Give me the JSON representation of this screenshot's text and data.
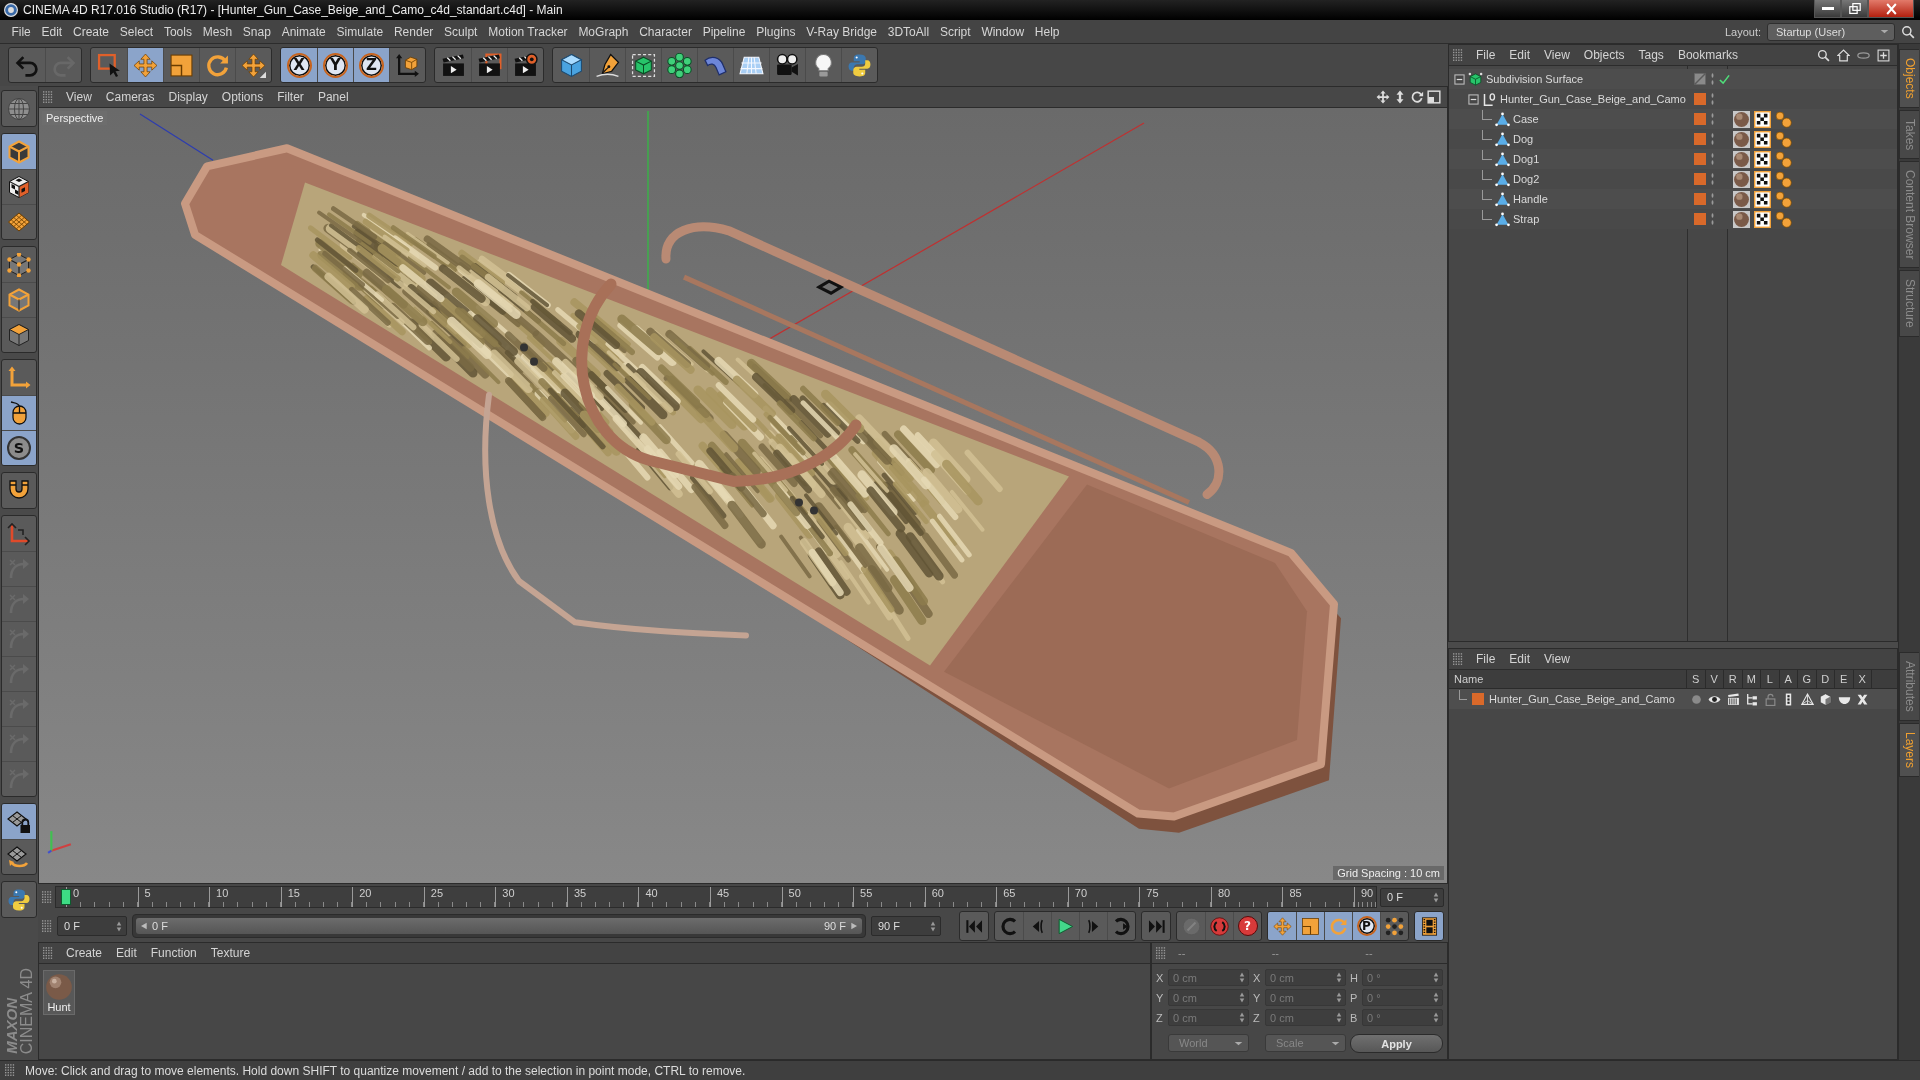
{
  "window": {
    "title": "CINEMA 4D R17.016 Studio (R17) - [Hunter_Gun_Case_Beige_and_Camo_c4d_standart.c4d] - Main"
  },
  "menu_bar": {
    "items": [
      "File",
      "Edit",
      "Create",
      "Select",
      "Tools",
      "Mesh",
      "Snap",
      "Animate",
      "Simulate",
      "Render",
      "Sculpt",
      "Motion Tracker",
      "MoGraph",
      "Character",
      "Pipeline",
      "Plugins",
      "V-Ray Bridge",
      "3DToAll",
      "Script",
      "Window",
      "Help"
    ],
    "layout_label": "Layout:",
    "layout_value": "Startup (User)"
  },
  "toolbar": {
    "groups": [
      [
        {
          "kind": "undo",
          "selected": false,
          "disabled": false
        },
        {
          "kind": "redo",
          "selected": false,
          "disabled": true
        }
      ],
      [
        {
          "kind": "live-select",
          "selected": false,
          "disabled": false
        },
        {
          "kind": "move",
          "selected": true,
          "disabled": false
        },
        {
          "kind": "scale",
          "selected": false,
          "disabled": false
        },
        {
          "kind": "rotate",
          "selected": false,
          "disabled": false
        },
        {
          "kind": "recent",
          "selected": false,
          "disabled": false
        }
      ],
      [
        {
          "kind": "axis-lock",
          "label": "X",
          "selected": true,
          "disabled": false
        },
        {
          "kind": "axis-lock",
          "label": "Y",
          "selected": true,
          "disabled": false
        },
        {
          "kind": "axis-lock",
          "label": "Z",
          "selected": true,
          "disabled": false
        },
        {
          "kind": "coord-system",
          "selected": false,
          "disabled": false
        }
      ],
      [
        {
          "kind": "render-view",
          "selected": false,
          "disabled": false
        },
        {
          "kind": "render-pv",
          "selected": false,
          "disabled": false
        },
        {
          "kind": "render-settings",
          "selected": false,
          "disabled": false
        }
      ],
      [
        {
          "kind": "cube",
          "selected": false,
          "disabled": false
        },
        {
          "kind": "pen",
          "selected": false,
          "disabled": false
        },
        {
          "kind": "subdivision",
          "selected": false,
          "disabled": false
        },
        {
          "kind": "cloner",
          "selected": false,
          "disabled": false
        },
        {
          "kind": "bend",
          "selected": false,
          "disabled": false
        },
        {
          "kind": "floor",
          "selected": false,
          "disabled": false
        },
        {
          "kind": "camera",
          "selected": false,
          "disabled": false
        },
        {
          "kind": "light",
          "selected": false,
          "disabled": false
        },
        {
          "kind": "python",
          "selected": false,
          "disabled": false
        }
      ]
    ]
  },
  "tools": {
    "groups": [
      [
        {
          "kind": "make-editable",
          "selected": false,
          "disabled": false
        }
      ],
      [
        {
          "kind": "model",
          "selected": true,
          "disabled": false
        },
        {
          "kind": "texture",
          "selected": false,
          "disabled": false
        },
        {
          "kind": "workplane",
          "selected": false,
          "disabled": false
        }
      ],
      [
        {
          "kind": "points",
          "selected": false,
          "disabled": false
        },
        {
          "kind": "edges",
          "selected": false,
          "disabled": false
        },
        {
          "kind": "polygons",
          "selected": false,
          "disabled": false
        }
      ],
      [
        {
          "kind": "axis-mode",
          "selected": false,
          "disabled": false
        },
        {
          "kind": "tweak",
          "selected": true,
          "disabled": false
        },
        {
          "kind": "solo",
          "label": "S",
          "selected": true,
          "disabled": false
        }
      ],
      [
        {
          "kind": "snap",
          "selected": false,
          "disabled": false
        }
      ],
      [
        {
          "kind": "axis-corner",
          "selected": false,
          "disabled": false
        },
        {
          "kind": "quantize",
          "selected": false,
          "disabled": true
        },
        {
          "kind": "lock-position",
          "selected": false,
          "disabled": true
        },
        {
          "kind": "lock-rotation",
          "selected": false,
          "disabled": true
        },
        {
          "kind": "lock-all",
          "selected": false,
          "disabled": true
        },
        {
          "kind": "target",
          "selected": false,
          "disabled": true
        },
        {
          "kind": "frame",
          "selected": false,
          "disabled": true
        },
        {
          "kind": "paint",
          "selected": false,
          "disabled": true
        }
      ],
      [
        {
          "kind": "grid-lock",
          "selected": true,
          "disabled": false
        },
        {
          "kind": "grid-orient",
          "selected": false,
          "disabled": false
        }
      ],
      [
        {
          "kind": "python",
          "selected": false,
          "disabled": false
        }
      ]
    ]
  },
  "viewport": {
    "menu": [
      "View",
      "Cameras",
      "Display",
      "Options",
      "Filter",
      "Panel"
    ],
    "camera": "Perspective",
    "grid_spacing": "Grid Spacing : 10 cm"
  },
  "timeline": {
    "ticks": [
      "0",
      "5",
      "10",
      "15",
      "20",
      "25",
      "30",
      "35",
      "40",
      "45",
      "50",
      "55",
      "60",
      "65",
      "70",
      "75",
      "80",
      "85",
      "90"
    ],
    "playhead": {
      "level": 0
    },
    "current_frame": "0 F",
    "start_field": "0 F",
    "range": {
      "start": "0 F",
      "end": "90 F",
      "level": 1
    },
    "end_field": "90 F",
    "transport": {
      "groups": [
        [
          {
            "kind": "goto-start",
            "selected": false,
            "disabled": false
          }
        ],
        [
          {
            "kind": "prev-key",
            "selected": false,
            "disabled": false
          },
          {
            "kind": "prev-frame",
            "selected": false,
            "disabled": false
          },
          {
            "kind": "play",
            "selected": false,
            "disabled": false
          },
          {
            "kind": "next-frame",
            "selected": false,
            "disabled": false
          },
          {
            "kind": "next-key",
            "selected": false,
            "disabled": false
          }
        ],
        [
          {
            "kind": "goto-end",
            "selected": false,
            "disabled": false
          }
        ],
        [
          {
            "kind": "record",
            "selected": false,
            "disabled": true
          },
          {
            "kind": "autokey",
            "selected": false,
            "disabled": false
          },
          {
            "kind": "key-selection",
            "label": "?",
            "selected": false,
            "disabled": false
          }
        ],
        [
          {
            "kind": "key-move",
            "selected": true,
            "disabled": false
          },
          {
            "kind": "key-scale",
            "selected": true,
            "disabled": false
          },
          {
            "kind": "key-rotate",
            "selected": true,
            "disabled": false
          },
          {
            "kind": "key-param",
            "label": "P",
            "selected": true,
            "disabled": false
          },
          {
            "kind": "key-points",
            "selected": false,
            "disabled": false
          }
        ],
        [
          {
            "kind": "timeline",
            "selected": true,
            "disabled": false
          }
        ]
      ]
    }
  },
  "materials": {
    "menu": [
      "Create",
      "Edit",
      "Function",
      "Texture"
    ],
    "items": [
      {
        "name": "Hunt"
      }
    ]
  },
  "coordinates": {
    "disabled": true,
    "columns": [
      {
        "header": "--",
        "fields": [
          {
            "label": "X",
            "value": "0 cm"
          },
          {
            "label": "Y",
            "value": "0 cm"
          },
          {
            "label": "Z",
            "value": "0 cm"
          }
        ],
        "dropdown": "World"
      },
      {
        "header": "--",
        "fields": [
          {
            "label": "X",
            "value": "0 cm"
          },
          {
            "label": "Y",
            "value": "0 cm"
          },
          {
            "label": "Z",
            "value": "0 cm"
          }
        ],
        "dropdown": "Scale"
      },
      {
        "header": "--",
        "fields": [
          {
            "label": "H",
            "value": "0 °"
          },
          {
            "label": "P",
            "value": "0 °"
          },
          {
            "label": "B",
            "value": "0 °"
          }
        ],
        "button": "Apply"
      }
    ]
  },
  "object_manager": {
    "menu": [
      "File",
      "Edit",
      "View",
      "Objects",
      "Tags",
      "Bookmarks"
    ],
    "objects": [
      {
        "name": "Subdivision Surface",
        "kind": "subdivision",
        "enabled": true,
        "expanded": true,
        "children": [
          {
            "name": "Hunter_Gun_Case_Beige_and_Camo",
            "kind": "null",
            "color": "#d9692a",
            "expanded": true,
            "children": [
              {
                "name": "Case",
                "kind": "polygon",
                "color": "#d9692a",
                "tags": [
                  {
                    "kind": "material"
                  },
                  {
                    "kind": "uvw"
                  },
                  {
                    "kind": "phong"
                  }
                ]
              },
              {
                "name": "Dog",
                "kind": "polygon",
                "color": "#d9692a",
                "tags": [
                  {
                    "kind": "material"
                  },
                  {
                    "kind": "uvw"
                  },
                  {
                    "kind": "phong"
                  }
                ]
              },
              {
                "name": "Dog1",
                "kind": "polygon",
                "color": "#d9692a",
                "tags": [
                  {
                    "kind": "material"
                  },
                  {
                    "kind": "uvw"
                  },
                  {
                    "kind": "phong"
                  }
                ]
              },
              {
                "name": "Dog2",
                "kind": "polygon",
                "color": "#d9692a",
                "tags": [
                  {
                    "kind": "material"
                  },
                  {
                    "kind": "uvw"
                  },
                  {
                    "kind": "phong"
                  }
                ]
              },
              {
                "name": "Handle",
                "kind": "polygon",
                "color": "#d9692a",
                "tags": [
                  {
                    "kind": "material"
                  },
                  {
                    "kind": "uvw"
                  },
                  {
                    "kind": "phong"
                  }
                ]
              },
              {
                "name": "Strap",
                "kind": "polygon",
                "color": "#d9692a",
                "tags": [
                  {
                    "kind": "material"
                  },
                  {
                    "kind": "uvw"
                  },
                  {
                    "kind": "phong"
                  }
                ]
              }
            ]
          }
        ]
      }
    ]
  },
  "layer_manager": {
    "menu": [
      "File",
      "Edit",
      "View"
    ],
    "columns": [
      "Name",
      "S",
      "V",
      "R",
      "M",
      "L",
      "A",
      "G",
      "D",
      "E",
      "X"
    ],
    "layers": [
      {
        "name": "Hunter_Gun_Case_Beige_and_Camo",
        "color": "#d9692a",
        "toggles": [
          {
            "kind": "solo",
            "on": false
          },
          {
            "kind": "visible",
            "on": true
          },
          {
            "kind": "render",
            "on": true
          },
          {
            "kind": "manager",
            "on": true
          },
          {
            "kind": "locked",
            "on": false
          },
          {
            "kind": "animation",
            "on": true
          },
          {
            "kind": "generators",
            "on": true
          },
          {
            "kind": "deformers",
            "on": true
          },
          {
            "kind": "expressions",
            "on": true
          },
          {
            "kind": "xrefs",
            "on": true
          }
        ]
      }
    ]
  },
  "side_tabs": {
    "upper": [
      {
        "label": "Objects",
        "selected": true
      },
      {
        "label": "Takes",
        "selected": false
      },
      {
        "label": "Content Browser",
        "selected": false
      },
      {
        "label": "Structure",
        "selected": false
      }
    ],
    "lower": [
      {
        "label": "Attributes",
        "selected": false
      },
      {
        "label": "Layers",
        "selected": true
      }
    ]
  },
  "logo": {
    "brand": "MAXON",
    "product": "CINEMA 4D"
  },
  "status_bar": {
    "text": "Move: Click and drag to move elements. Hold down SHIFT to quantize movement / add to the selection in point mode, CTRL to remove."
  }
}
